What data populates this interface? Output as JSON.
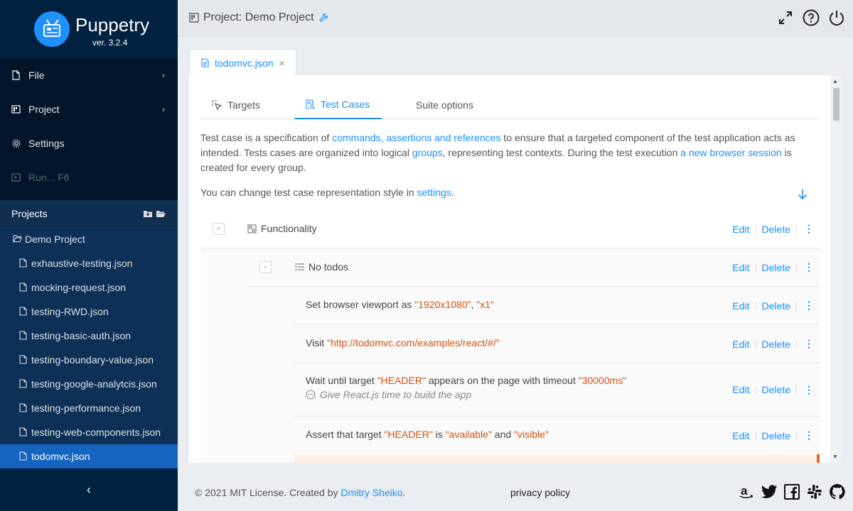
{
  "app": {
    "name": "Puppetry",
    "version": "ver. 3.2.4"
  },
  "sidebar": {
    "menu": [
      {
        "label": "File",
        "icon": "file-icon",
        "has_submenu": true
      },
      {
        "label": "Project",
        "icon": "project-icon",
        "has_submenu": true
      },
      {
        "label": "Settings",
        "icon": "gear-icon",
        "has_submenu": false
      },
      {
        "label": "Run... F6",
        "icon": "run-icon",
        "has_submenu": false,
        "disabled": true
      }
    ],
    "projects_heading": "Projects",
    "project_name": "Demo Project",
    "files": [
      "exhaustive-testing.json",
      "mocking-request.json",
      "testing-RWD.json",
      "testing-basic-auth.json",
      "testing-boundary-value.json",
      "testing-google-analytcis.json",
      "testing-performance.json",
      "testing-web-components.json",
      "todomvc.json"
    ],
    "active_file": "todomvc.json",
    "collapse_glyph": "‹"
  },
  "header": {
    "title": "Project: Demo Project"
  },
  "doc_tab": {
    "label": "todomvc.json",
    "close": "×"
  },
  "tabs": [
    {
      "label": "Targets",
      "active": false
    },
    {
      "label": "Test Cases",
      "active": true
    },
    {
      "label": "Suite options",
      "active": false
    }
  ],
  "intro": {
    "p1_a": "Test case is a specification of ",
    "p1_link1": "commands, assertions and references",
    "p1_b": " to ensure that a targeted component of the test application acts as intended. Tests cases are organized into logical ",
    "p1_link2": "groups",
    "p1_c": ", representing test contexts. During the test execution ",
    "p1_link3": "a new browser session",
    "p1_d": " is created for every group.",
    "p2_a": "You can change test case representation style in ",
    "p2_link": "settings",
    "p2_b": "."
  },
  "actions": {
    "edit": "Edit",
    "delete": "Delete",
    "more": "⋮",
    "collapse": "-"
  },
  "suite": {
    "group": "Functionality",
    "test": "No todos",
    "commands": [
      {
        "parts": [
          {
            "t": "Set browser viewport as "
          },
          {
            "s": "\"1920x1080\""
          },
          {
            "t": ", "
          },
          {
            "s": "\"x1\""
          }
        ]
      },
      {
        "parts": [
          {
            "t": "Visit "
          },
          {
            "s": "\"http://todomvc.com/examples/react/#/\""
          }
        ]
      },
      {
        "parts": [
          {
            "t": "Wait until target "
          },
          {
            "s": "\"HEADER\""
          },
          {
            "t": " appears on the page with timeout "
          },
          {
            "s": "\"30000ms\""
          }
        ],
        "comment": "Give React.js time to build the app"
      },
      {
        "parts": [
          {
            "t": "Assert that target "
          },
          {
            "s": "\"HEADER\""
          },
          {
            "t": " is "
          },
          {
            "s": "\"available\""
          },
          {
            "t": " and "
          },
          {
            "s": "\"visible\""
          }
        ]
      }
    ]
  },
  "footer": {
    "copy_prefix": "© 2021 MIT License. Created by ",
    "author": "Dmitry Sheiko",
    "copy_suffix": ".",
    "privacy": "privacy policy"
  },
  "colors": {
    "accent": "#1890ff",
    "string": "#d4520f",
    "sidebar_bg": "#001529",
    "active_file_bg": "#1565c0"
  }
}
